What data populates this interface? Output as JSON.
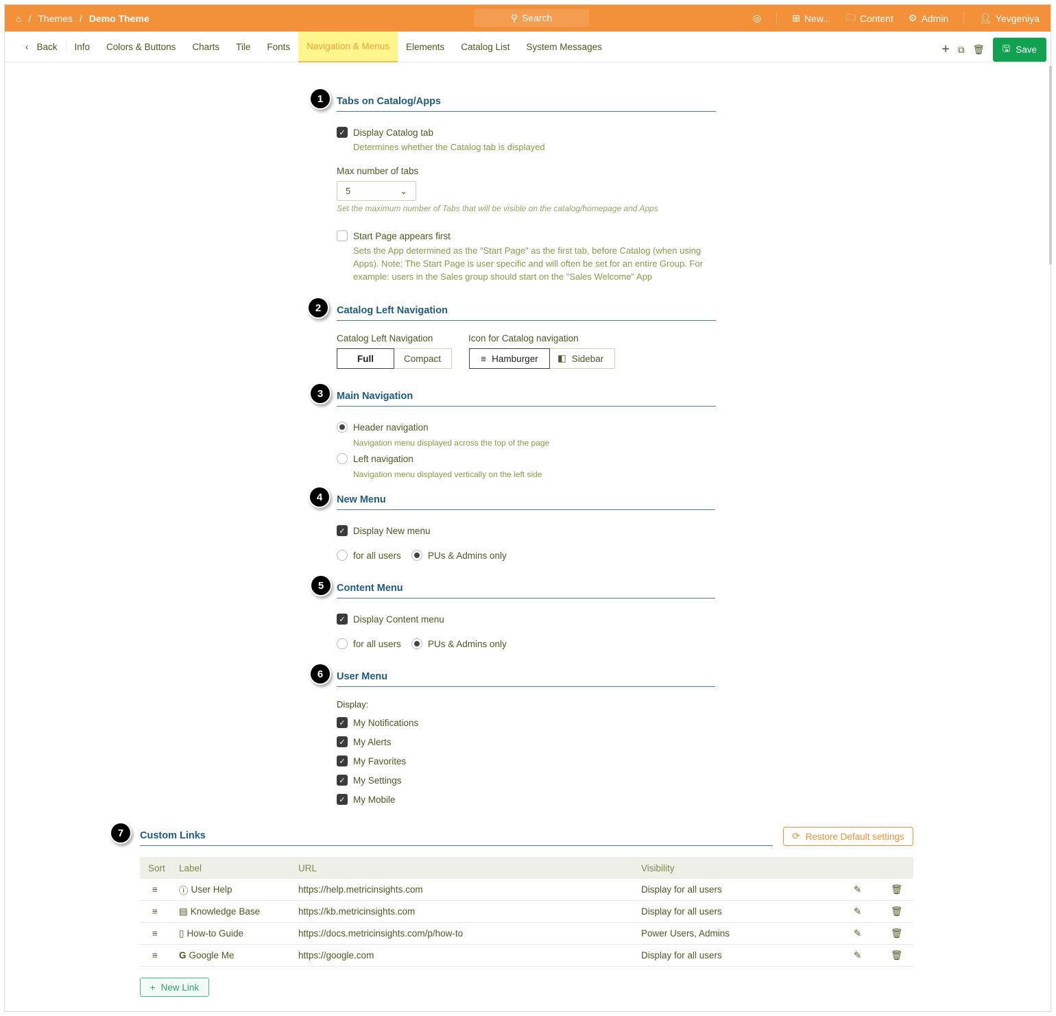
{
  "header": {
    "breadcrumb": [
      "Themes",
      "Demo Theme"
    ],
    "search": "Search",
    "new": "New...",
    "content": "Content",
    "admin": "Admin",
    "user": "Yevgeniya"
  },
  "tabs": {
    "back": "Back",
    "items": [
      "Info",
      "Colors & Buttons",
      "Charts",
      "Tile",
      "Fonts",
      "Navigation & Menus",
      "Elements",
      "Catalog List",
      "System Messages"
    ],
    "active": "Navigation & Menus",
    "save": "Save"
  },
  "s1": {
    "num": "1",
    "title": "Tabs on Catalog/Apps",
    "display_catalog": "Display Catalog tab",
    "display_catalog_desc": "Determines whether the Catalog tab is displayed",
    "max_label": "Max number of tabs",
    "max_value": "5",
    "max_hint": "Set the maximum number of Tabs that will be visible on the catalog/homepage and Apps",
    "start_page": "Start Page appears first",
    "start_desc": "Sets the App determined as the \"Start Page\" as the first tab, before Catalog (when using Apps). Note: The Start Page is user specific and will often be set for an entire Group. For example: users in the Sales group should start on the \"Sales Welcome\" App"
  },
  "s2": {
    "num": "2",
    "title": "Catalog Left Navigation",
    "nav_label": "Catalog Left Navigation",
    "full": "Full",
    "compact": "Compact",
    "icon_label": "Icon for Catalog navigation",
    "hamburger": "Hamburger",
    "sidebar": "Sidebar"
  },
  "s3": {
    "num": "3",
    "title": "Main Navigation",
    "header_nav": "Header navigation",
    "header_desc": "Navigation menu displayed across the top of the page",
    "left_nav": "Left navigation",
    "left_desc": "Navigation menu displayed vertically on the left side"
  },
  "s4": {
    "num": "4",
    "title": "New Menu",
    "display": "Display New menu",
    "all": "for all users",
    "pus": "PUs & Admins only"
  },
  "s5": {
    "num": "5",
    "title": "Content Menu",
    "display": "Display Content menu",
    "all": "for all users",
    "pus": "PUs & Admins only"
  },
  "s6": {
    "num": "6",
    "title": "User Menu",
    "display": "Display:",
    "items": [
      "My Notifications",
      "My Alerts",
      "My Favorites",
      "My Settings",
      "My Mobile"
    ]
  },
  "s7": {
    "num": "7",
    "title": "Custom Links",
    "restore": "Restore Default settings",
    "cols": [
      "Sort",
      "Label",
      "URL",
      "Visibility"
    ],
    "rows": [
      {
        "label": "User Help",
        "url": "https://help.metricinsights.com",
        "vis": "Display for all users"
      },
      {
        "label": "Knowledge Base",
        "url": "https://kb.metricinsights.com",
        "vis": "Display for all users"
      },
      {
        "label": "How-to Guide",
        "url": "https://docs.metricinsights.com/p/how-to",
        "vis": "Power Users, Admins"
      },
      {
        "label": "Google Me",
        "url": "https://google.com",
        "vis": "Display for all users"
      }
    ],
    "new_link": "New Link"
  }
}
